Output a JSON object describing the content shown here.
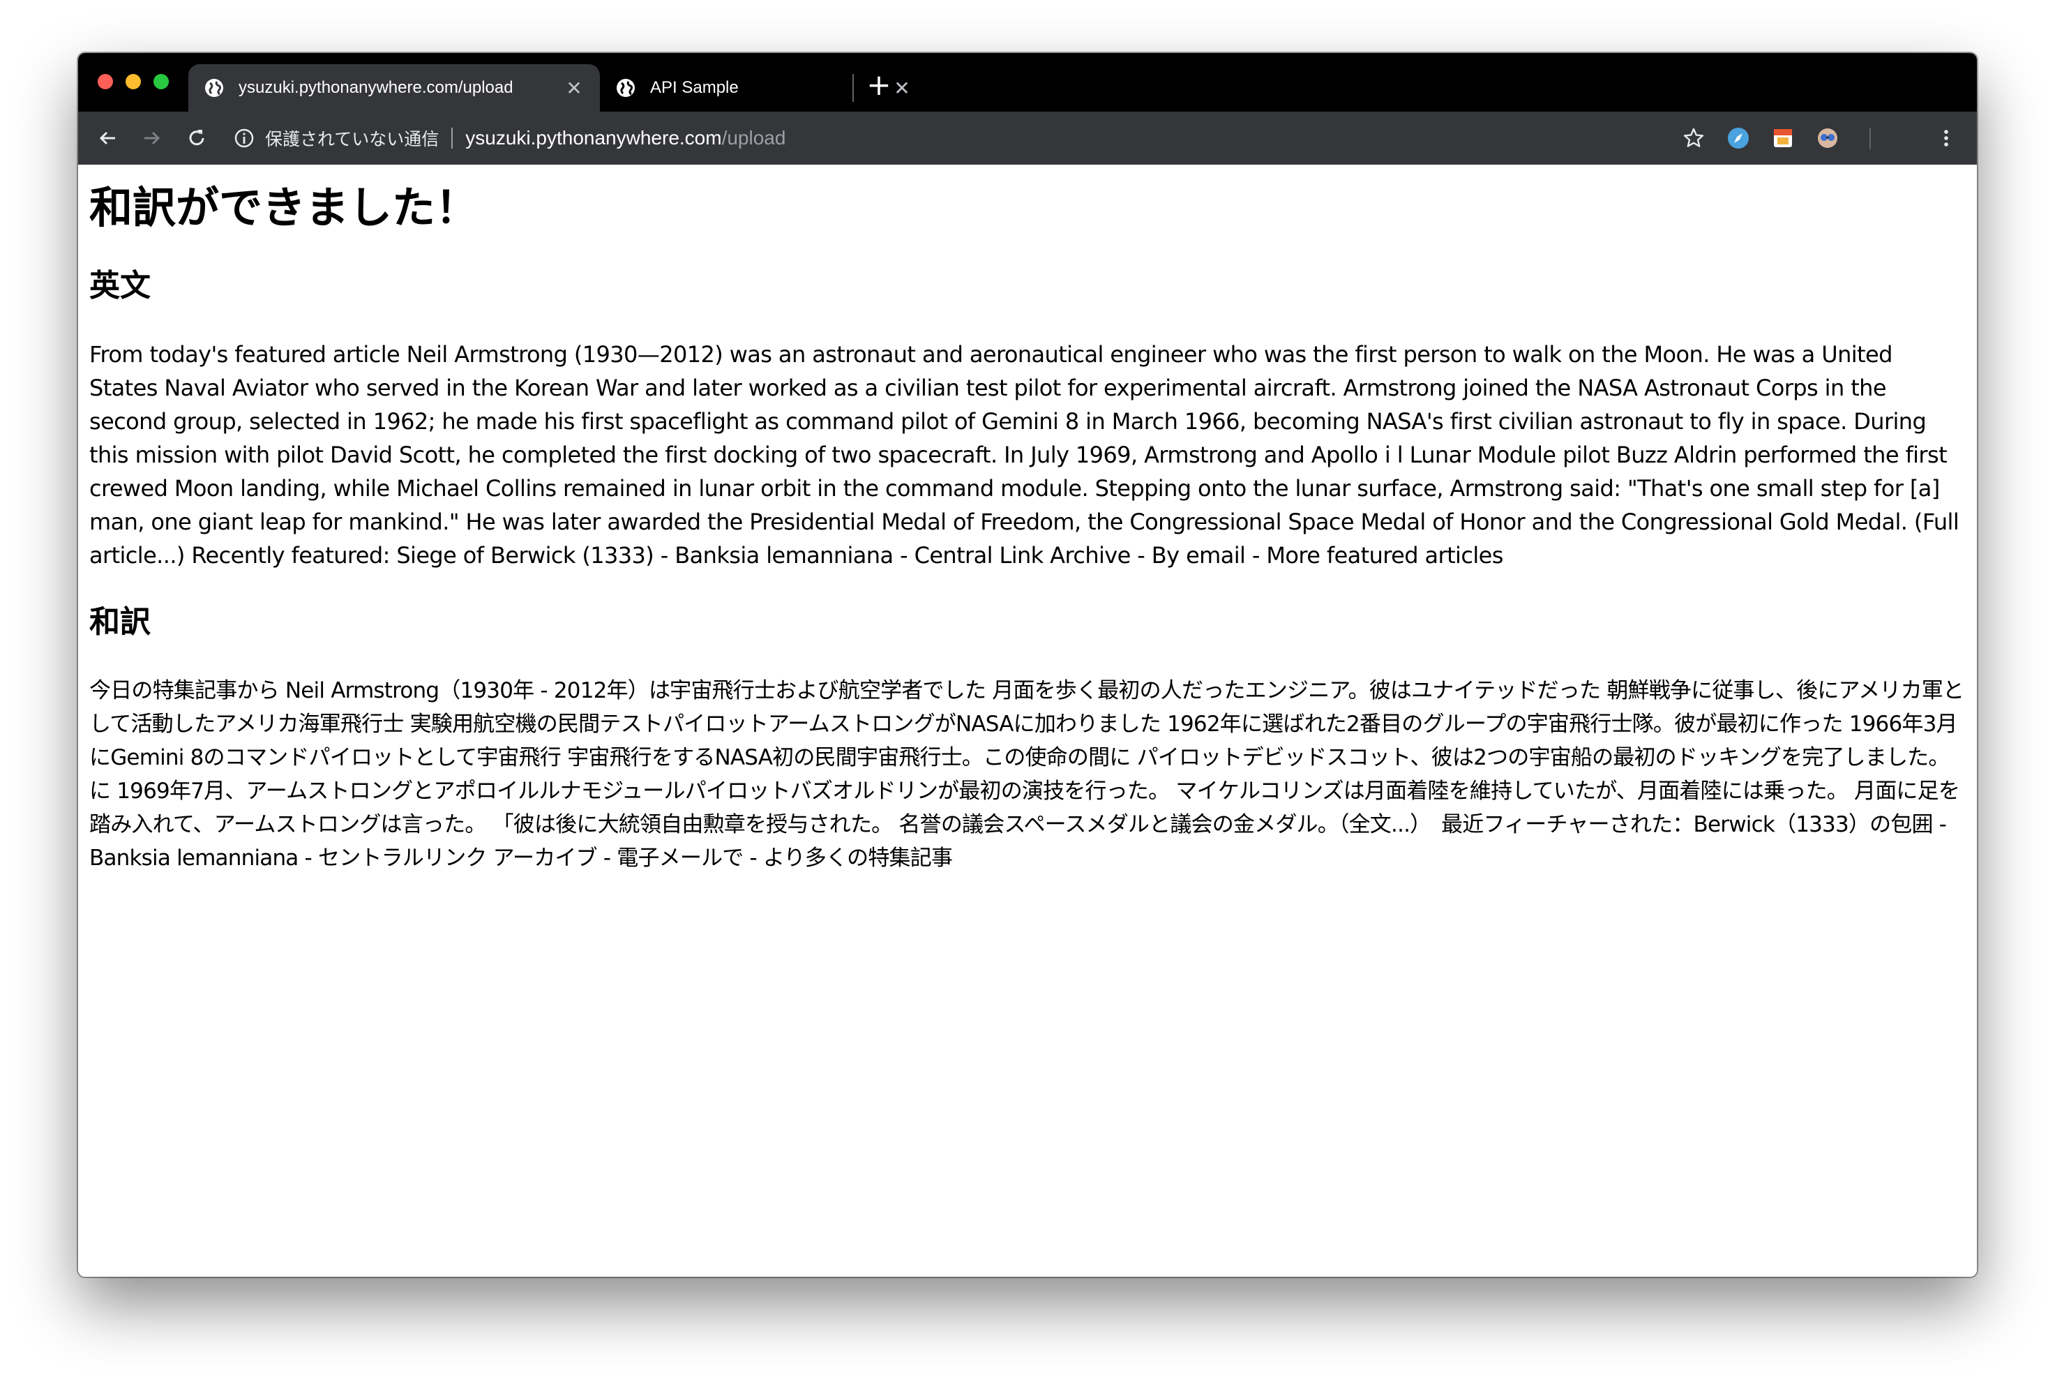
{
  "browser": {
    "tabs": [
      {
        "title": "ysuzuki.pythonanywhere.com/upload",
        "active": true,
        "close": "✕"
      },
      {
        "title": "API Sample",
        "active": false,
        "close": "✕"
      }
    ],
    "new_tab": "+",
    "address": {
      "security_label": "保護されていない通信",
      "host": "ysuzuki.pythonanywhere.com",
      "path": "/upload"
    },
    "icons": {
      "tab_favicon": "globe-icon",
      "back": "back-arrow-icon",
      "forward": "forward-arrow-icon",
      "reload": "reload-icon",
      "security": "info-icon",
      "bookmark": "star-icon",
      "menu": "kebab-menu-icon",
      "extensions": [
        "compass-extension-icon",
        "image-extension-icon",
        "glasses-extension-icon"
      ]
    },
    "colors": {
      "tabstrip": "#000000",
      "toolbar": "#35363a",
      "active_tab": "#35363a"
    }
  },
  "page": {
    "heading": "和訳ができました！",
    "english_heading": "英文",
    "english_text": "From today's featured article Neil Armstrong (1930—2012) was an astronaut and aeronautical engineer who was the first person to walk on the Moon. He was a United States Naval Aviator who served in the Korean War and later worked as a civilian test pilot for experimental aircraft. Armstrong joined the NASA Astronaut Corps in the second group, selected in 1962; he made his first spaceflight as command pilot of Gemini 8 in March 1966, becoming NASA's first civilian astronaut to fly in space. During this mission with pilot David Scott, he completed the first docking of two spacecraft. In July 1969, Armstrong and Apollo i l Lunar Module pilot Buzz Aldrin performed the first crewed Moon landing, while Michael Collins remained in lunar orbit in the command module. Stepping onto the lunar surface, Armstrong said: \"That's one small step for [a] man, one giant leap for mankind.\" He was later awarded the Presidential Medal of Freedom, the Congressional Space Medal of Honor and the Congressional Gold Medal. (Full article...) Recently featured: Siege of Berwick (1333) - Banksia lemanniana - Central Link Archive - By email - More featured articles",
    "japanese_heading": "和訳",
    "japanese_text": "今日の特集記事から Neil Armstrong（1930年 - 2012年）は宇宙飛行士および航空学者でした 月面を歩く最初の人だったエンジニア。彼はユナイテッドだった 朝鮮戦争に従事し、後にアメリカ軍として活動したアメリカ海軍飛行士 実験用航空機の民間テストパイロットアームストロングがNASAに加わりました 1962年に選ばれた2番目のグループの宇宙飛行士隊。彼が最初に作った 1966年3月にGemini 8のコマンドパイロットとして宇宙飛行 宇宙飛行をするNASA初の民間宇宙飛行士。この使命の間に パイロットデビッドスコット、彼は2つの宇宙船の最初のドッキングを完了しました。に 1969年7月、アームストロングとアポロイルルナモジュールパイロットバズオルドリンが最初の演技を行った。 マイケルコリンズは月面着陸を維持していたが、月面着陸には乗った。 月面に足を踏み入れて、アームストロングは言った。 「彼は後に大統領自由勲章を授与された。 名誉の議会スペースメダルと議会の金メダル。（全文...）　最近フィーチャーされた：Berwick（1333）の包囲 - Banksia lemanniana - セントラルリンク アーカイブ - 電子メールで - より多くの特集記事"
  }
}
